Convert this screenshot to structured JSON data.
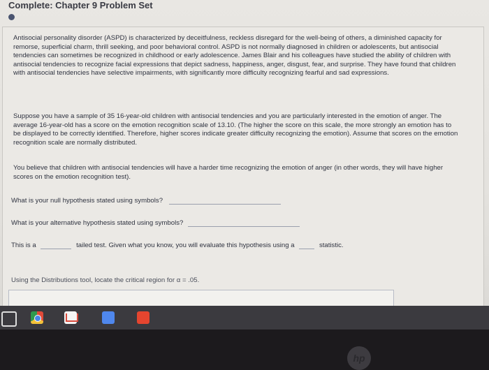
{
  "header": {
    "title": "Complete: Chapter 9 Problem Set"
  },
  "problem": {
    "intro": "Antisocial personality disorder (ASPD) is characterized by deceitfulness, reckless disregard for the well-being of others, a diminished capacity for remorse, superficial charm, thrill seeking, and poor behavioral control. ASPD is not normally diagnosed in children or adolescents, but antisocial tendencies can sometimes be recognized in childhood or early adolescence. James Blair and his colleagues have studied the ability of children with antisocial tendencies to recognize facial expressions that depict sadness, happiness, anger, disgust, fear, and surprise. They have found that children with antisocial tendencies have selective impairments, with significantly more difficulty recognizing fearful and sad expressions.",
    "scenario": "Suppose you have a sample of 35 16-year-old children with antisocial tendencies and you are particularly interested in the emotion of anger. The average 16-year-old has a score on the emotion recognition scale of 13.10. (The higher the score on this scale, the more strongly an emotion has to be displayed to be correctly identified. Therefore, higher scores indicate greater difficulty recognizing the emotion). Assume that scores on the emotion recognition scale are normally distributed.",
    "belief": "You believe that children with antisocial tendencies will have a harder time recognizing the emotion of anger (in other words, they will have higher scores on the emotion recognition test)."
  },
  "questions": {
    "null_hypothesis": "What is your null hypothesis stated using symbols?",
    "alt_hypothesis": "What is your alternative hypothesis stated using symbols?",
    "test_prefix": "This is a",
    "test_middle": "tailed test. Given what you know, you will evaluate this hypothesis using a",
    "test_suffix": "statistic.",
    "critical_region": "Using the Distributions tool, locate the critical region for α = .05."
  },
  "taskbar": {
    "icons": [
      "circle-icon",
      "chrome-icon",
      "gmail-icon",
      "docs-icon",
      "slides-icon"
    ]
  },
  "laptop": {
    "logo": "hp"
  }
}
